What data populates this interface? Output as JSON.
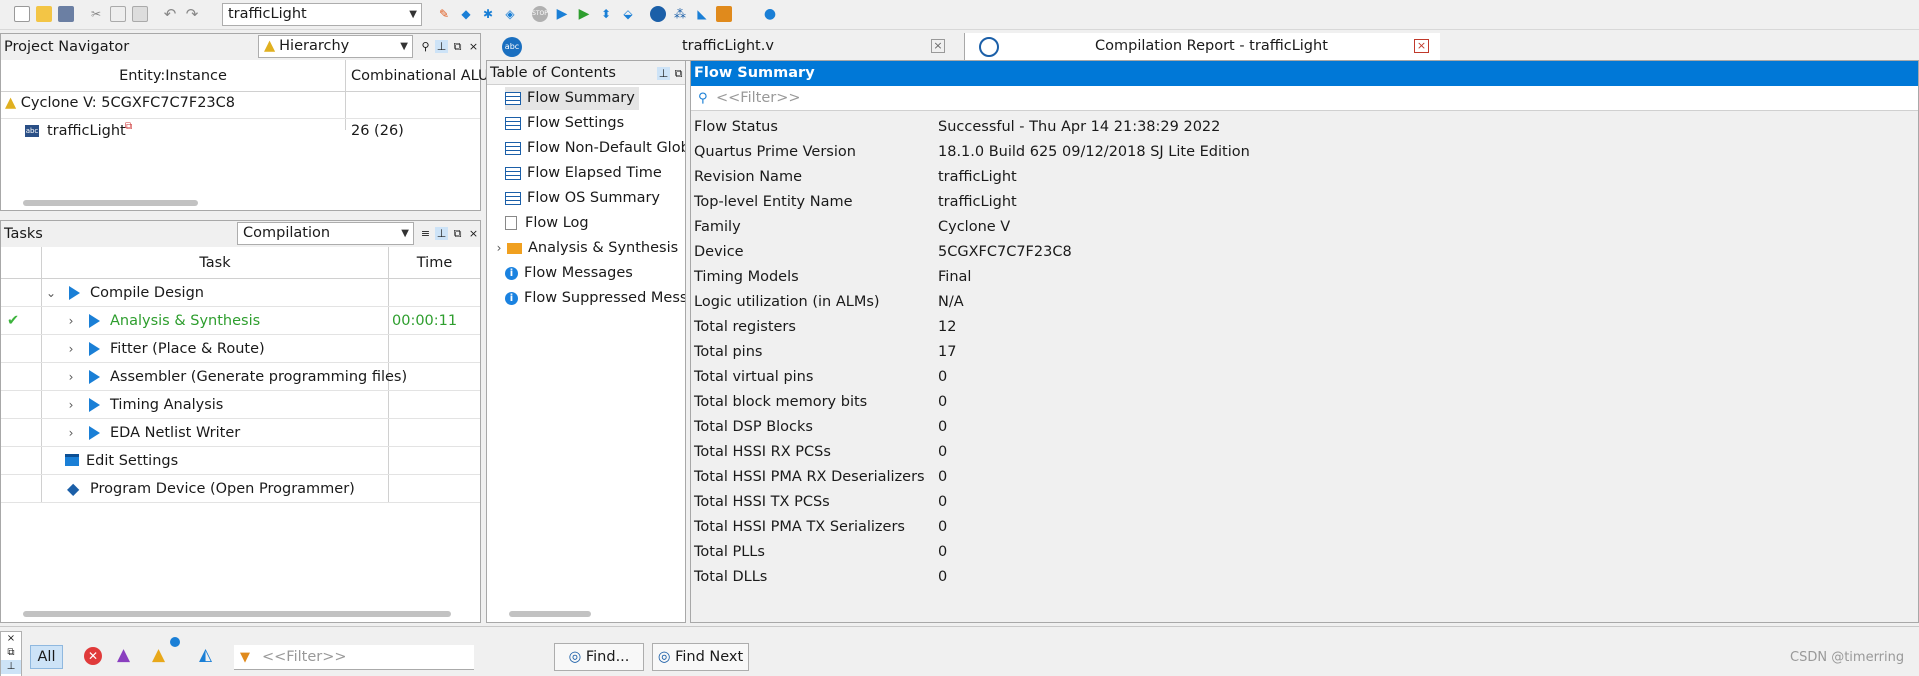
{
  "toolbar": {
    "project_combo": "trafficLight",
    "icons": [
      "new-file-icon",
      "open-file-icon",
      "save-icon",
      "cut-icon",
      "copy-icon",
      "paste-icon",
      "undo-icon",
      "redo-icon",
      "pin-planner-icon",
      "assignment-editor-icon",
      "settings-icon",
      "analysis-icon",
      "stop-icon",
      "start-compilation-icon",
      "start-analysis-icon",
      "rtl-viewer-icon",
      "programmer-icon",
      "chip-planner-icon",
      "netlist-viewer-icon",
      "signal-tap-icon",
      "ip-catalog-icon",
      "help-chat-icon"
    ]
  },
  "project_navigator": {
    "title": "Project Navigator",
    "view_combo": "Hierarchy",
    "columns": [
      "Entity:Instance",
      "Combinational ALU"
    ],
    "device": "Cyclone V: 5CGXFC7C7F23C8",
    "rows": [
      {
        "name": "trafficLight",
        "alut": "26 (26)"
      }
    ]
  },
  "tasks": {
    "title": "Tasks",
    "flow_combo": "Compilation",
    "columns": [
      "Task",
      "Time"
    ],
    "items": [
      {
        "label": "Compile Design",
        "time": ""
      },
      {
        "label": "Analysis & Synthesis",
        "time": "00:00:11"
      },
      {
        "label": "Fitter (Place & Route)",
        "time": ""
      },
      {
        "label": "Assembler (Generate programming files)",
        "time": ""
      },
      {
        "label": "Timing Analysis",
        "time": ""
      },
      {
        "label": "EDA Netlist Writer",
        "time": ""
      },
      {
        "label": "Edit Settings",
        "time": ""
      },
      {
        "label": "Program Device (Open Programmer)",
        "time": ""
      }
    ]
  },
  "tabs": {
    "file_tab": "trafficLight.v",
    "report_tab": "Compilation Report - trafficLight"
  },
  "toc": {
    "title": "Table of Contents",
    "items": [
      {
        "label": "Flow Summary",
        "icon": "table-icon"
      },
      {
        "label": "Flow Settings",
        "icon": "table-icon"
      },
      {
        "label": "Flow Non-Default Glob",
        "icon": "table-icon"
      },
      {
        "label": "Flow Elapsed Time",
        "icon": "table-icon"
      },
      {
        "label": "Flow OS Summary",
        "icon": "table-icon"
      },
      {
        "label": "Flow Log",
        "icon": "document-icon"
      },
      {
        "label": "Analysis & Synthesis",
        "icon": "folder-icon"
      },
      {
        "label": "Flow Messages",
        "icon": "info-icon"
      },
      {
        "label": "Flow Suppressed Mess",
        "icon": "info-icon"
      }
    ]
  },
  "report": {
    "title": "Flow Summary",
    "filter_placeholder": "<<Filter>>",
    "rows": [
      {
        "key": "Flow Status",
        "value": "Successful - Thu Apr 14 21:38:29 2022"
      },
      {
        "key": "Quartus Prime Version",
        "value": "18.1.0 Build 625 09/12/2018 SJ Lite Edition"
      },
      {
        "key": "Revision Name",
        "value": "trafficLight"
      },
      {
        "key": "Top-level Entity Name",
        "value": "trafficLight"
      },
      {
        "key": "Family",
        "value": "Cyclone V"
      },
      {
        "key": "Device",
        "value": "5CGXFC7C7F23C8"
      },
      {
        "key": "Timing Models",
        "value": "Final"
      },
      {
        "key": "Logic utilization (in ALMs)",
        "value": "N/A"
      },
      {
        "key": "Total registers",
        "value": "12"
      },
      {
        "key": "Total pins",
        "value": "17"
      },
      {
        "key": "Total virtual pins",
        "value": "0"
      },
      {
        "key": "Total block memory bits",
        "value": "0"
      },
      {
        "key": "Total DSP Blocks",
        "value": "0"
      },
      {
        "key": "Total HSSI RX PCSs",
        "value": "0"
      },
      {
        "key": "Total HSSI PMA RX Deserializers",
        "value": "0"
      },
      {
        "key": "Total HSSI TX PCSs",
        "value": "0"
      },
      {
        "key": "Total HSSI PMA TX Serializers",
        "value": "0"
      },
      {
        "key": "Total PLLs",
        "value": "0"
      },
      {
        "key": "Total DLLs",
        "value": "0"
      }
    ]
  },
  "messages": {
    "all_label": "All",
    "filter_placeholder": "<<Filter>>",
    "find_label": "Find...",
    "find_next_label": "Find Next",
    "watermark": "CSDN @timerring"
  },
  "colors": {
    "accent": "#1a7fd6",
    "success": "#2e9e2e",
    "selected_bg": "#0078d7"
  }
}
